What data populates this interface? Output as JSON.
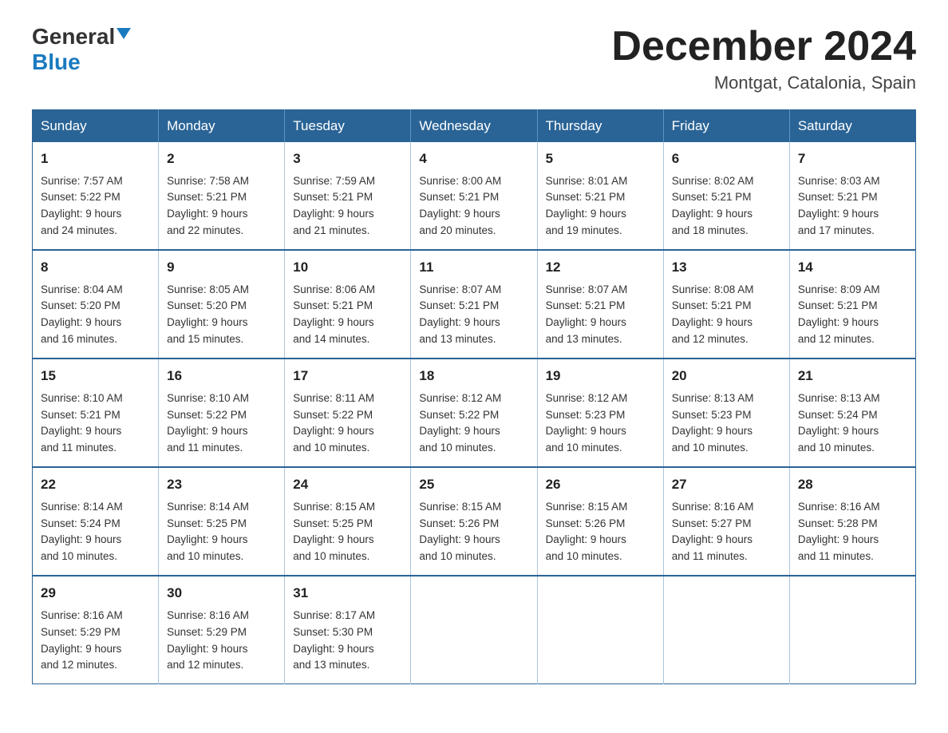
{
  "logo": {
    "general": "General",
    "blue": "Blue",
    "arrow": "▼"
  },
  "title": {
    "month": "December 2024",
    "location": "Montgat, Catalonia, Spain"
  },
  "weekdays": [
    "Sunday",
    "Monday",
    "Tuesday",
    "Wednesday",
    "Thursday",
    "Friday",
    "Saturday"
  ],
  "weeks": [
    [
      {
        "day": "1",
        "sunrise": "7:57 AM",
        "sunset": "5:22 PM",
        "daylight": "9 hours and 24 minutes."
      },
      {
        "day": "2",
        "sunrise": "7:58 AM",
        "sunset": "5:21 PM",
        "daylight": "9 hours and 22 minutes."
      },
      {
        "day": "3",
        "sunrise": "7:59 AM",
        "sunset": "5:21 PM",
        "daylight": "9 hours and 21 minutes."
      },
      {
        "day": "4",
        "sunrise": "8:00 AM",
        "sunset": "5:21 PM",
        "daylight": "9 hours and 20 minutes."
      },
      {
        "day": "5",
        "sunrise": "8:01 AM",
        "sunset": "5:21 PM",
        "daylight": "9 hours and 19 minutes."
      },
      {
        "day": "6",
        "sunrise": "8:02 AM",
        "sunset": "5:21 PM",
        "daylight": "9 hours and 18 minutes."
      },
      {
        "day": "7",
        "sunrise": "8:03 AM",
        "sunset": "5:21 PM",
        "daylight": "9 hours and 17 minutes."
      }
    ],
    [
      {
        "day": "8",
        "sunrise": "8:04 AM",
        "sunset": "5:20 PM",
        "daylight": "9 hours and 16 minutes."
      },
      {
        "day": "9",
        "sunrise": "8:05 AM",
        "sunset": "5:20 PM",
        "daylight": "9 hours and 15 minutes."
      },
      {
        "day": "10",
        "sunrise": "8:06 AM",
        "sunset": "5:21 PM",
        "daylight": "9 hours and 14 minutes."
      },
      {
        "day": "11",
        "sunrise": "8:07 AM",
        "sunset": "5:21 PM",
        "daylight": "9 hours and 13 minutes."
      },
      {
        "day": "12",
        "sunrise": "8:07 AM",
        "sunset": "5:21 PM",
        "daylight": "9 hours and 13 minutes."
      },
      {
        "day": "13",
        "sunrise": "8:08 AM",
        "sunset": "5:21 PM",
        "daylight": "9 hours and 12 minutes."
      },
      {
        "day": "14",
        "sunrise": "8:09 AM",
        "sunset": "5:21 PM",
        "daylight": "9 hours and 12 minutes."
      }
    ],
    [
      {
        "day": "15",
        "sunrise": "8:10 AM",
        "sunset": "5:21 PM",
        "daylight": "9 hours and 11 minutes."
      },
      {
        "day": "16",
        "sunrise": "8:10 AM",
        "sunset": "5:22 PM",
        "daylight": "9 hours and 11 minutes."
      },
      {
        "day": "17",
        "sunrise": "8:11 AM",
        "sunset": "5:22 PM",
        "daylight": "9 hours and 10 minutes."
      },
      {
        "day": "18",
        "sunrise": "8:12 AM",
        "sunset": "5:22 PM",
        "daylight": "9 hours and 10 minutes."
      },
      {
        "day": "19",
        "sunrise": "8:12 AM",
        "sunset": "5:23 PM",
        "daylight": "9 hours and 10 minutes."
      },
      {
        "day": "20",
        "sunrise": "8:13 AM",
        "sunset": "5:23 PM",
        "daylight": "9 hours and 10 minutes."
      },
      {
        "day": "21",
        "sunrise": "8:13 AM",
        "sunset": "5:24 PM",
        "daylight": "9 hours and 10 minutes."
      }
    ],
    [
      {
        "day": "22",
        "sunrise": "8:14 AM",
        "sunset": "5:24 PM",
        "daylight": "9 hours and 10 minutes."
      },
      {
        "day": "23",
        "sunrise": "8:14 AM",
        "sunset": "5:25 PM",
        "daylight": "9 hours and 10 minutes."
      },
      {
        "day": "24",
        "sunrise": "8:15 AM",
        "sunset": "5:25 PM",
        "daylight": "9 hours and 10 minutes."
      },
      {
        "day": "25",
        "sunrise": "8:15 AM",
        "sunset": "5:26 PM",
        "daylight": "9 hours and 10 minutes."
      },
      {
        "day": "26",
        "sunrise": "8:15 AM",
        "sunset": "5:26 PM",
        "daylight": "9 hours and 10 minutes."
      },
      {
        "day": "27",
        "sunrise": "8:16 AM",
        "sunset": "5:27 PM",
        "daylight": "9 hours and 11 minutes."
      },
      {
        "day": "28",
        "sunrise": "8:16 AM",
        "sunset": "5:28 PM",
        "daylight": "9 hours and 11 minutes."
      }
    ],
    [
      {
        "day": "29",
        "sunrise": "8:16 AM",
        "sunset": "5:29 PM",
        "daylight": "9 hours and 12 minutes."
      },
      {
        "day": "30",
        "sunrise": "8:16 AM",
        "sunset": "5:29 PM",
        "daylight": "9 hours and 12 minutes."
      },
      {
        "day": "31",
        "sunrise": "8:17 AM",
        "sunset": "5:30 PM",
        "daylight": "9 hours and 13 minutes."
      },
      null,
      null,
      null,
      null
    ]
  ],
  "labels": {
    "sunrise": "Sunrise:",
    "sunset": "Sunset:",
    "daylight": "Daylight:"
  }
}
